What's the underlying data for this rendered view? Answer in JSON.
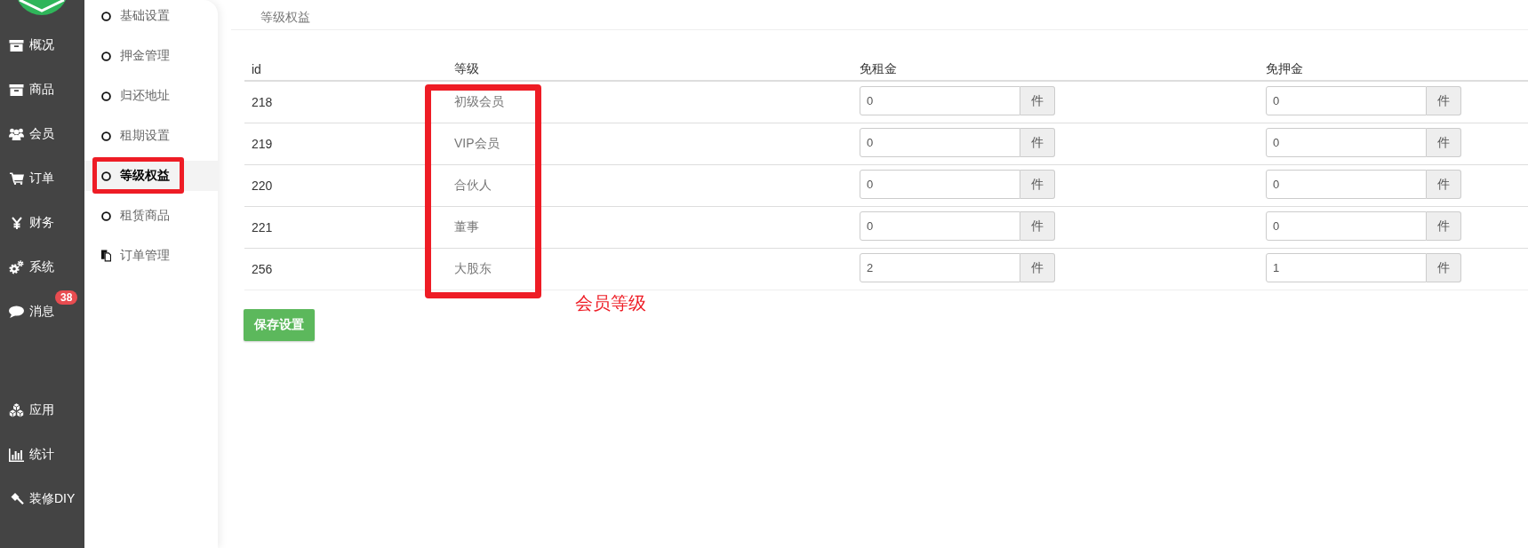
{
  "main_nav": {
    "top": [
      {
        "label": "概况"
      },
      {
        "label": "商品"
      },
      {
        "label": "会员"
      },
      {
        "label": "订单"
      },
      {
        "label": "财务"
      },
      {
        "label": "系统"
      },
      {
        "label": "消息",
        "badge": "38"
      }
    ],
    "bottom": [
      {
        "label": "应用"
      },
      {
        "label": "统计"
      },
      {
        "label": "装修DIY"
      }
    ]
  },
  "sub_nav": {
    "items": [
      {
        "label": "基础设置",
        "selected": false,
        "annotated": false
      },
      {
        "label": "押金管理",
        "selected": false,
        "annotated": false
      },
      {
        "label": "归还地址",
        "selected": false,
        "annotated": false
      },
      {
        "label": "租期设置",
        "selected": false,
        "annotated": false
      },
      {
        "label": "等级权益",
        "selected": true,
        "annotated": true
      },
      {
        "label": "租赁商品",
        "selected": false,
        "annotated": false
      },
      {
        "label": "订单管理",
        "selected": false,
        "annotated": false
      }
    ]
  },
  "page_title": "等级权益",
  "table": {
    "columns": [
      {
        "label": "id",
        "annotated": false
      },
      {
        "label": "等级",
        "annotated": true
      },
      {
        "label": "免租金",
        "annotated": false
      },
      {
        "label": "免押金",
        "annotated": false
      }
    ],
    "rows": [
      {
        "cells": [
          {
            "kind": "text",
            "text": "218"
          },
          {
            "kind": "text",
            "text": "初级会员"
          },
          {
            "kind": "input",
            "value": "0",
            "unit": "件"
          },
          {
            "kind": "input",
            "value": "0",
            "unit": "件"
          }
        ]
      },
      {
        "cells": [
          {
            "kind": "text",
            "text": "219"
          },
          {
            "kind": "text",
            "text": "VIP会员"
          },
          {
            "kind": "input",
            "value": "0",
            "unit": "件"
          },
          {
            "kind": "input",
            "value": "0",
            "unit": "件"
          }
        ]
      },
      {
        "cells": [
          {
            "kind": "text",
            "text": "220"
          },
          {
            "kind": "text",
            "text": "合伙人"
          },
          {
            "kind": "input",
            "value": "0",
            "unit": "件"
          },
          {
            "kind": "input",
            "value": "0",
            "unit": "件"
          }
        ]
      },
      {
        "cells": [
          {
            "kind": "text",
            "text": "221"
          },
          {
            "kind": "text",
            "text": "董事"
          },
          {
            "kind": "input",
            "value": "0",
            "unit": "件"
          },
          {
            "kind": "input",
            "value": "0",
            "unit": "件"
          }
        ]
      },
      {
        "cells": [
          {
            "kind": "text",
            "text": "256"
          },
          {
            "kind": "text",
            "text": "大股东"
          },
          {
            "kind": "input",
            "value": "2",
            "unit": "件"
          },
          {
            "kind": "input",
            "value": "1",
            "unit": "件"
          }
        ]
      }
    ]
  },
  "annotation": {
    "label": "会员等级"
  },
  "save_button": {
    "label": "保存设置"
  }
}
